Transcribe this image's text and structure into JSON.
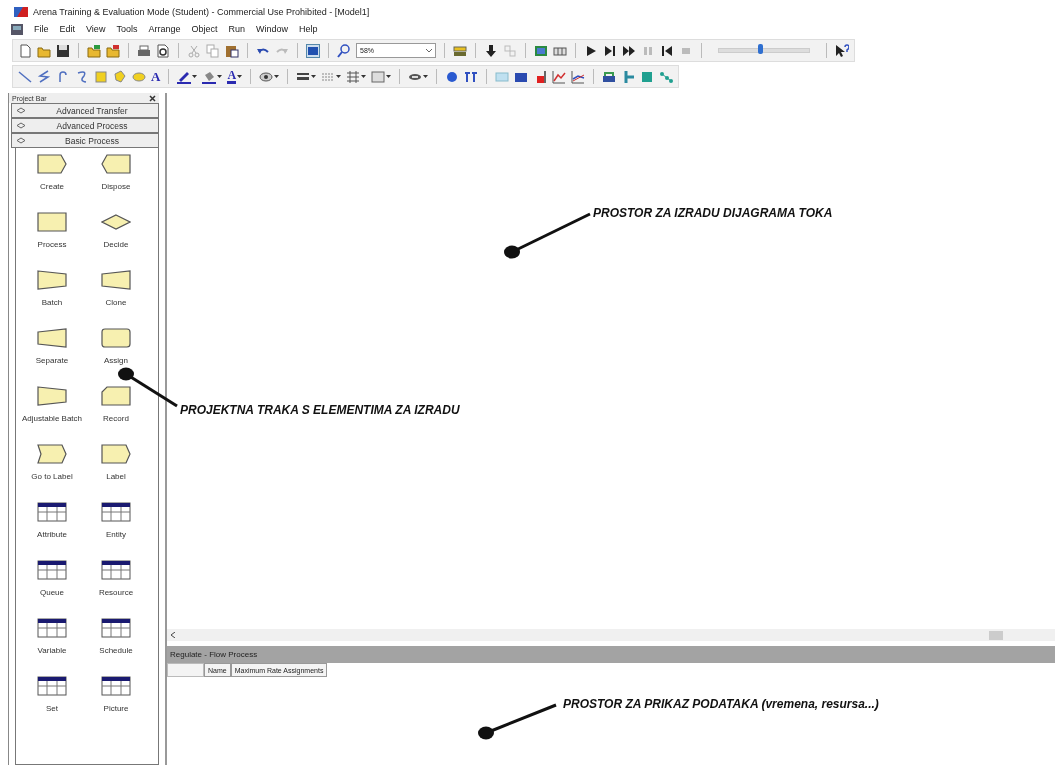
{
  "window": {
    "title": "Arena Training & Evaluation Mode (Student) - Commercial Use Prohibited - [Model1]"
  },
  "menu": [
    "File",
    "Edit",
    "View",
    "Tools",
    "Arrange",
    "Object",
    "Run",
    "Window",
    "Help"
  ],
  "toolbar": {
    "zoom": "58%",
    "speed_slider": {
      "level": 0.45
    }
  },
  "draw_toolbar": {
    "text_tool": "A",
    "text_color": "A"
  },
  "project_bar": {
    "title": "Project Bar",
    "panels": [
      {
        "label": "Advanced Transfer"
      },
      {
        "label": "Advanced Process"
      },
      {
        "label": "Basic Process"
      }
    ],
    "modules": [
      {
        "label": "Create",
        "kind": "create"
      },
      {
        "label": "Dispose",
        "kind": "dispose"
      },
      {
        "label": "Process",
        "kind": "process"
      },
      {
        "label": "Decide",
        "kind": "decide"
      },
      {
        "label": "Batch",
        "kind": "batch"
      },
      {
        "label": "Clone",
        "kind": "clone"
      },
      {
        "label": "Separate",
        "kind": "separate"
      },
      {
        "label": "Assign",
        "kind": "assign"
      },
      {
        "label": "Adjustable Batch",
        "kind": "batch"
      },
      {
        "label": "Record",
        "kind": "record"
      },
      {
        "label": "Go to Label",
        "kind": "goto"
      },
      {
        "label": "Label",
        "kind": "label"
      },
      {
        "label": "Attribute",
        "kind": "data"
      },
      {
        "label": "Entity",
        "kind": "data"
      },
      {
        "label": "Queue",
        "kind": "data"
      },
      {
        "label": "Resource",
        "kind": "data"
      },
      {
        "label": "Variable",
        "kind": "data"
      },
      {
        "label": "Schedule",
        "kind": "data"
      },
      {
        "label": "Set",
        "kind": "data"
      },
      {
        "label": "Picture",
        "kind": "data"
      }
    ]
  },
  "data_view": {
    "title": "Regulate - Flow Process",
    "columns": [
      "Name",
      "Maximum Rate Assignments"
    ]
  },
  "annotations": [
    {
      "text": "PROSTOR ZA IZRADU DIJAGRAMA TOKA"
    },
    {
      "text": "PROJEKTNA TRAKA S ELEMENTIMA ZA IZRADU"
    },
    {
      "text": "PROSTOR ZA PRIKAZ PODATAKA (vremena, resursa...)"
    }
  ]
}
